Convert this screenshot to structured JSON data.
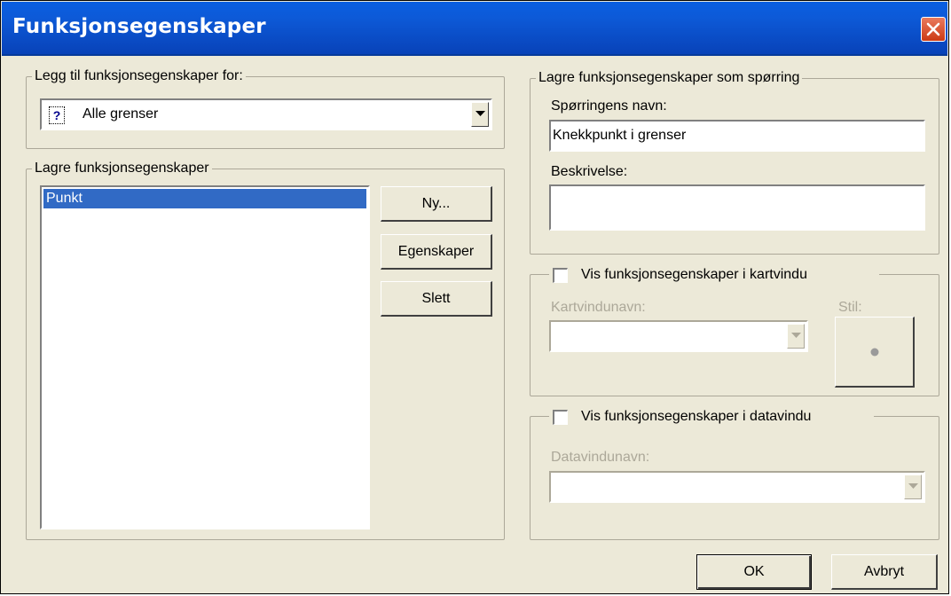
{
  "window": {
    "title": "Funksjonsegenskaper"
  },
  "add_for": {
    "legend": "Legg til funksjonsegenskaper for:",
    "selected_value": "Alle grenser",
    "icon": "question-mark-icon"
  },
  "saved": {
    "legend": "Lagre funksjonsegenskaper",
    "items": [
      "Punkt"
    ],
    "new_label": "Ny...",
    "properties_label": "Egenskaper",
    "delete_label": "Slett"
  },
  "query": {
    "legend": "Lagre funksjonsegenskaper som spørring",
    "name_label": "Spørringens navn:",
    "name_value": "Knekkpunkt i grenser",
    "desc_label": "Beskrivelse:",
    "desc_value": ""
  },
  "map_window": {
    "check_label": "Vis funksjonsegenskaper i kartvindu",
    "checked": false,
    "name_label": "Kartvindunavn:",
    "name_value": "",
    "style_label": "Stil:"
  },
  "data_window": {
    "check_label": "Vis funksjonsegenskaper i datavindu",
    "checked": false,
    "name_label": "Datavindunavn:",
    "name_value": ""
  },
  "footer": {
    "ok_label": "OK",
    "cancel_label": "Avbryt"
  }
}
